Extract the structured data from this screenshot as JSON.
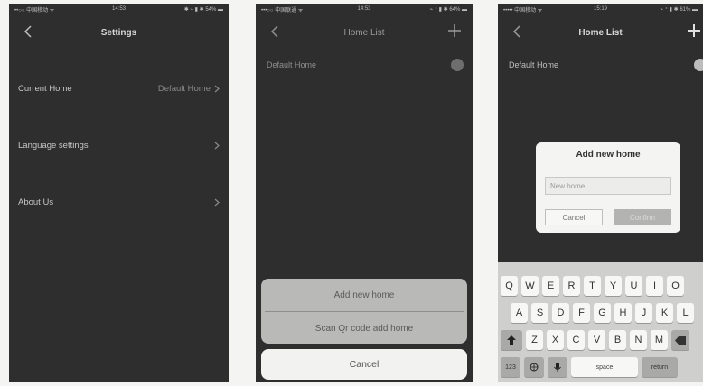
{
  "colors": {
    "screen_bg": "#2e2e2e",
    "page_bg": "#f4f4f2",
    "sheet_bg": "#b9b9b7",
    "dialog_bg": "#f4f4f2",
    "keyboard_bg": "#cfcfcd"
  },
  "screen1": {
    "status": {
      "carrier": "••○○ 中国移动 ᯤ",
      "time": "14:53",
      "battery": "✱ ⌁ ▮ ✱ 54% ▬"
    },
    "title": "Settings",
    "back_icon": "chevron-left-icon",
    "rows": [
      {
        "label": "Current Home",
        "value": "Default Home"
      },
      {
        "label": "Language settings",
        "value": ""
      },
      {
        "label": "About Us",
        "value": ""
      }
    ]
  },
  "screen2": {
    "status": {
      "carrier": "•••○○ 中国联通 ᯤ",
      "time": "14:53",
      "battery": "⌁ ⁺ ▮ ✱ 64% ▬"
    },
    "title": "Home List",
    "home_name": "Default Home",
    "sheet": {
      "add": "Add new home",
      "scan": "Scan Qr code add home",
      "cancel": "Cancel"
    }
  },
  "screen3": {
    "status": {
      "carrier": "••••• 中国移动 ᯤ",
      "time": "15:19",
      "battery": "⌁ ⁺ ▮ ✱ 61% ▬"
    },
    "title": "Home List",
    "home_name": "Default Home",
    "dialog": {
      "title": "Add new home",
      "input_placeholder": "New home",
      "cancel": "Cancel",
      "confirm": "Confirm"
    },
    "keyboard": {
      "row1": [
        "Q",
        "W",
        "E",
        "R",
        "T",
        "Y",
        "U",
        "I",
        "O"
      ],
      "row2": [
        "A",
        "S",
        "D",
        "F",
        "G",
        "H",
        "J",
        "K",
        "L"
      ],
      "row3": [
        "Z",
        "X",
        "C",
        "V",
        "B",
        "N",
        "M"
      ],
      "numbers": "123",
      "space": "space",
      "return": "return"
    }
  }
}
